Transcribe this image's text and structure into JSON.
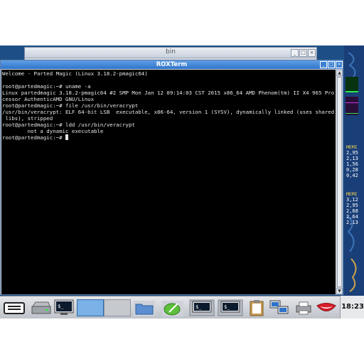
{
  "background_window": {
    "title": "bin",
    "controls": [
      "_",
      "□",
      "×"
    ]
  },
  "terminal": {
    "title": "ROXTerm",
    "controls": [
      "_",
      "□",
      "×"
    ],
    "lines": [
      "Welcome - Parted Magic (Linux 3.18.2-pmagic64)",
      "",
      "root@partedmagic:~# uname -a",
      "Linux partedmagic 3.18.2-pmagic64 #2 SMP Mon Jan 12 09:14:03 CST 2015 x86_64 AMD Phenom(tm) II X4 965 Pro",
      "cessor AuthenticAMD GNU/Linux",
      "root@partedmagic:~# file /usr/bin/veracrypt",
      "/usr/bin/veracrypt: ELF 64-bit LSB  executable, x86-64, version 1 (SYSV), dynamically linked (uses shared",
      " libs), stripped",
      "root@partedmagic:~# ldd /usr/bin/veracrypt",
      "        not a dynamic executable"
    ],
    "prompt": "root@partedmagic:~# "
  },
  "system_monitor": {
    "label_1": "MEMI",
    "values_1": [
      "2,95",
      "2,13",
      "1,56",
      "0,28",
      "0,42"
    ],
    "label_2": "MEMI",
    "values_2": [
      "3,12",
      "2,95",
      "2,68",
      "2,64",
      "2,13"
    ]
  },
  "taskbar": {
    "items": [
      {
        "name": "start-menu-icon"
      },
      {
        "name": "drive-icon"
      },
      {
        "name": "terminal-window-icon"
      },
      {
        "name": "desktop-pager-icon"
      },
      {
        "name": "file-manager-icon"
      },
      {
        "name": "editor-icon"
      },
      {
        "name": "terminal-task-icon"
      },
      {
        "name": "terminal-task-icon"
      },
      {
        "name": "clipboard-icon"
      },
      {
        "name": "network-icon"
      },
      {
        "name": "printer-icon"
      },
      {
        "name": "mouth-icon"
      }
    ],
    "clock": "18:23"
  },
  "colors": {
    "desktop": "#1d4f86",
    "titlebar_active": "#2f73c9",
    "terminal_bg": "#000000",
    "terminal_fg": "#e6e6e6",
    "monitor_label": "#ffd84a"
  }
}
